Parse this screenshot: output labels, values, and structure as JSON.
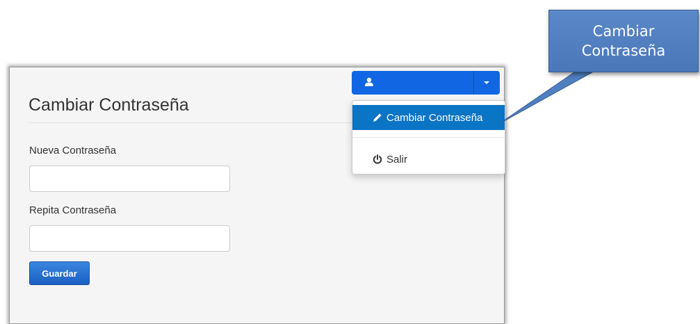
{
  "form": {
    "title": "Cambiar Contraseña",
    "new_password_label": "Nueva Contraseña",
    "new_password_value": "",
    "repeat_password_label": "Repita Contraseña",
    "repeat_password_value": "",
    "save_label": "Guardar"
  },
  "user_menu": {
    "user_icon": "user-icon",
    "caret_icon": "caret-down-icon",
    "items": [
      {
        "label": "Cambiar Contraseña",
        "icon": "pencil-icon",
        "active": true
      },
      {
        "label": "Salir",
        "icon": "power-icon",
        "active": false
      }
    ]
  },
  "callout": {
    "line1": "Cambiar",
    "line2": "Contraseña"
  },
  "colors": {
    "primary": "#1167e3",
    "active_item": "#0a74c5",
    "callout": "#4f7fc0",
    "panel_bg": "#f5f5f5"
  }
}
